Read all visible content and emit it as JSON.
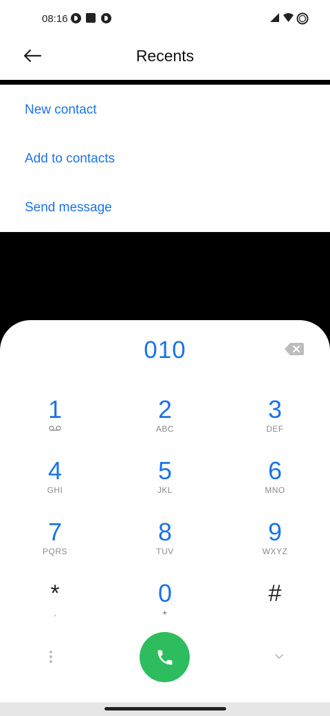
{
  "status_bar": {
    "time": "08:16",
    "icons": [
      "app-notification-icon",
      "stop-icon",
      "app-notification-icon",
      "signal-icon",
      "wifi-icon",
      "battery-icon"
    ]
  },
  "app_bar": {
    "title": "Recents",
    "back_icon": "arrow-left-icon"
  },
  "options": [
    "New contact",
    "Add to contacts",
    "Send message"
  ],
  "dialpad": {
    "number": "010",
    "backspace_icon": "backspace-icon",
    "keys": [
      {
        "digit": "1",
        "letters": "voicemail-icon"
      },
      {
        "digit": "2",
        "letters": "ABC"
      },
      {
        "digit": "3",
        "letters": "DEF"
      },
      {
        "digit": "4",
        "letters": "GHI"
      },
      {
        "digit": "5",
        "letters": "JKL"
      },
      {
        "digit": "6",
        "letters": "MNO"
      },
      {
        "digit": "7",
        "letters": "PQRS"
      },
      {
        "digit": "8",
        "letters": "TUV"
      },
      {
        "digit": "9",
        "letters": "WXYZ"
      },
      {
        "digit": "*",
        "letters": ","
      },
      {
        "digit": "0",
        "letters": "+"
      },
      {
        "digit": "#",
        "letters": ""
      }
    ],
    "more_icon": "more-vertical-icon",
    "call_icon": "phone-icon",
    "collapse_icon": "chevron-down-icon"
  },
  "colors": {
    "accent": "#1a73e8",
    "call_button": "#2dbd5f",
    "background_dim": "#000000",
    "surface": "#ffffff"
  }
}
